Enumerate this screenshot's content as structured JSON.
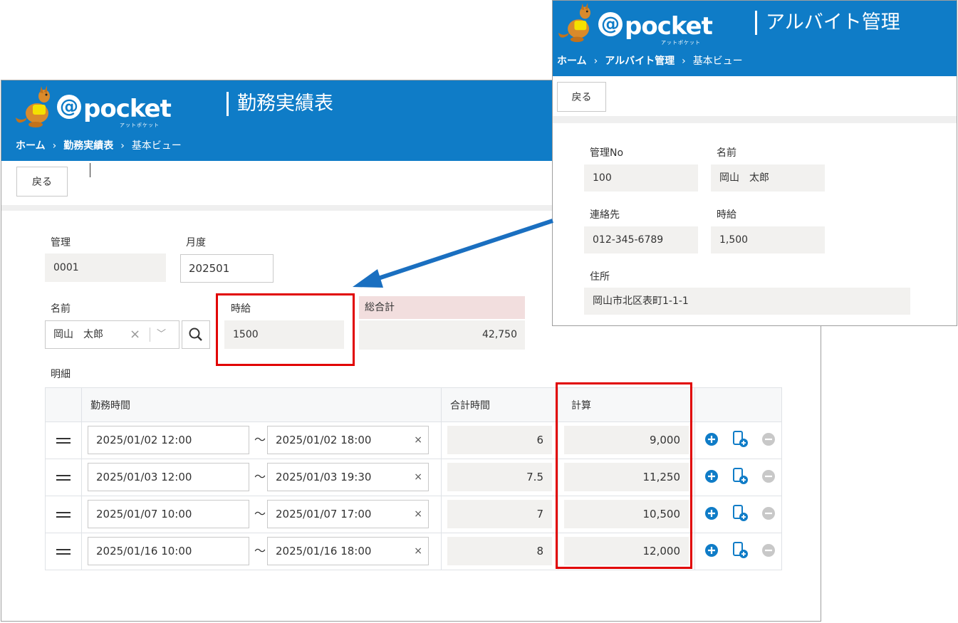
{
  "main": {
    "logo": {
      "brand": "pocket",
      "at": "@",
      "sub": "アットポケット"
    },
    "title": "勤務実績表",
    "breadcrumb": [
      "ホーム",
      "勤務実績表",
      "基本ビュー"
    ],
    "back_label": "戻る",
    "fields": {
      "kanri_label": "管理",
      "kanri_value": "0001",
      "month_label": "月度",
      "month_value": "202501",
      "name_label": "名前",
      "name_value": "岡山　太郎",
      "wage_label": "時給",
      "wage_value": "1500",
      "total_label": "総合計",
      "total_value": "42,750"
    },
    "detail_label": "明細",
    "table": {
      "headers": [
        "勤務時間",
        "合計時間",
        "計算"
      ],
      "rows": [
        {
          "start": "2025/01/02 12:00",
          "end": "2025/01/02 18:00",
          "hours": "6",
          "calc": "9,000"
        },
        {
          "start": "2025/01/03 12:00",
          "end": "2025/01/03 19:30",
          "hours": "7.5",
          "calc": "11,250"
        },
        {
          "start": "2025/01/07 10:00",
          "end": "2025/01/07 17:00",
          "hours": "7",
          "calc": "10,500"
        },
        {
          "start": "2025/01/16 10:00",
          "end": "2025/01/16 18:00",
          "hours": "8",
          "calc": "12,000"
        }
      ],
      "tilde": "～",
      "clear": "×"
    }
  },
  "popup": {
    "logo": {
      "brand": "pocket",
      "at": "@",
      "sub": "アットポケット"
    },
    "title": "アルバイト管理",
    "breadcrumb": [
      "ホーム",
      "アルバイト管理",
      "基本ビュー"
    ],
    "back_label": "戻る",
    "fields": {
      "no_label": "管理No",
      "no_value": "100",
      "name_label": "名前",
      "name_value": "岡山　太郎",
      "contact_label": "連絡先",
      "contact_value": "012-345-6789",
      "wage_label": "時給",
      "wage_value": "1,500",
      "address_label": "住所",
      "address_value": "岡山市北区表町1-1-1"
    }
  },
  "colors": {
    "header": "#0f7cc7",
    "highlight": "#e10000",
    "arrow": "#1a6fc0",
    "total_label_bg": "#f2dede"
  }
}
